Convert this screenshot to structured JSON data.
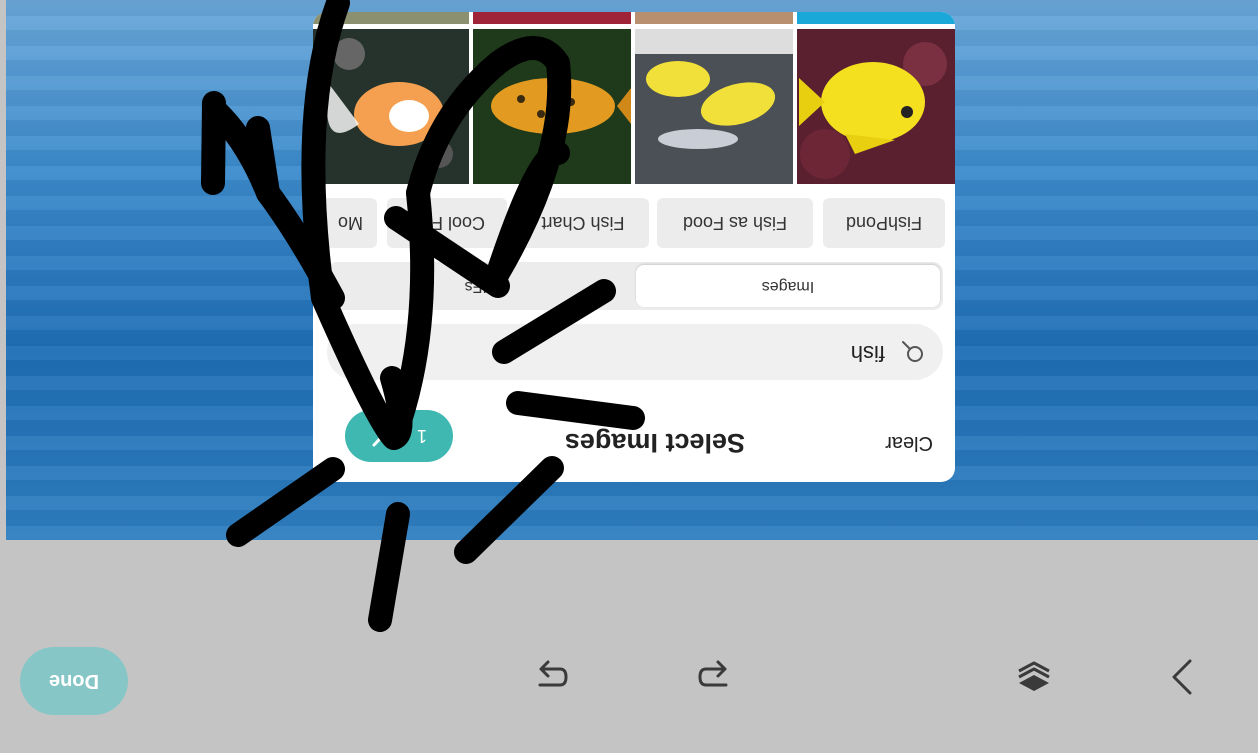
{
  "toolbar": {
    "done_label": "Done",
    "icons": [
      "chevron-right-icon",
      "layers-icon",
      "redo-icon",
      "undo-icon"
    ]
  },
  "picker": {
    "clear_label": "Clear",
    "title": "Select Images",
    "confirm_count": "1",
    "search_value": "fish",
    "tabs": [
      "Images",
      "GIFs"
    ],
    "chips": [
      "FishPond",
      "Fish as Food",
      "Fish Chart",
      "Cool Fish",
      "Mo"
    ],
    "colors": {
      "accent": "#3fb8b1",
      "done": "#87c6c6"
    }
  }
}
